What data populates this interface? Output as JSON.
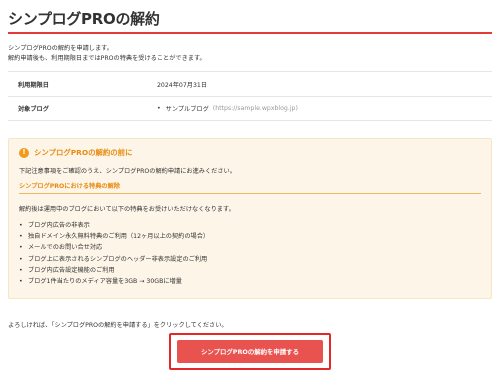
{
  "page": {
    "title": "シンプログPROの解約"
  },
  "intro": {
    "line1": "シンプログPROの解約を申請します。",
    "line2": "解約申請後も、利用期限日まではPROの特典を受けることができます。"
  },
  "info_table": {
    "rows": [
      {
        "label": "利用期限日",
        "value": "2024年07月31日"
      },
      {
        "label": "対象ブログ",
        "bullet": "•",
        "blog_name": "サンプルブログ",
        "blog_url": "(https://sample.wpxblog.jp)"
      }
    ]
  },
  "notice": {
    "icon": "warning-icon",
    "icon_glyph": "!",
    "title": "シンプログPROの解約の前に",
    "text": "下記注意事項をご確認のうえ、シンプログPROの解約申請にお進みください。",
    "subtitle": "シンプログPROにおける特典の解除",
    "description": "解約後は運用中のブログにおいて以下の特典をお受けいただけなくなります。",
    "bullet": "•",
    "benefits": [
      "ブログ内広告の非表示",
      "独自ドメイン永久無料特典のご利用（12ヶ月以上の契約の場合）",
      "メールでのお問い合せ対応",
      "ブログ上に表示されるシンプログのヘッダー非表示設定のご利用",
      "ブログ内広告設定機能のご利用",
      "ブログ1件当たりのメディア容量を3GB → 30GBに増量"
    ]
  },
  "confirm": {
    "text": "よろしければ、「シンプログPROの解約を申請する」をクリックしてください。",
    "button_label": "シンプログPROの解約を申請する"
  },
  "colors": {
    "accent_red": "#e22828",
    "button_red": "#e8534f",
    "notice_bg": "#fdf6e8",
    "notice_orange": "#e88a12"
  }
}
